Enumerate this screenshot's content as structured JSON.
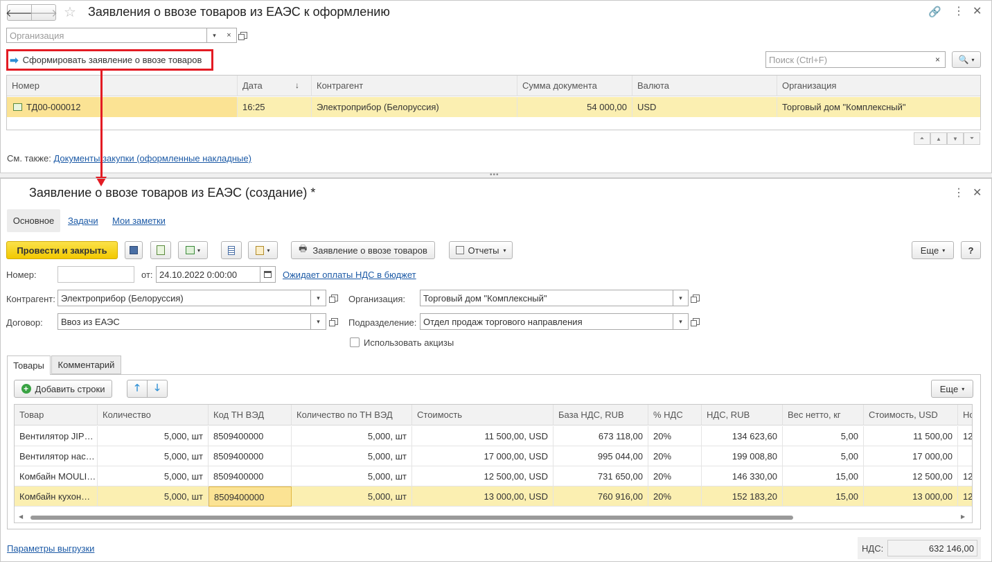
{
  "top": {
    "title": "Заявления о ввозе товаров из ЕАЭС к оформлению",
    "org_placeholder": "Организация",
    "create_button": "Сформировать заявление о ввозе товаров",
    "search_placeholder": "Поиск (Ctrl+F)",
    "columns": [
      "Номер",
      "Дата",
      "Контрагент",
      "Сумма документа",
      "Валюта",
      "Организация"
    ],
    "row": {
      "number": "ТД00-000012",
      "date": "16:25",
      "counterparty": "Электроприбор (Белоруссия)",
      "sum": "54 000,00",
      "currency": "USD",
      "organization": "Торговый дом \"Комплексный\""
    },
    "see_also_label": "См. также:",
    "see_also_link": "Документы закупки (оформленные накладные)"
  },
  "doc": {
    "title": "Заявление о ввозе товаров из ЕАЭС (создание) *",
    "tabs": [
      "Основное",
      "Задачи",
      "Мои заметки"
    ],
    "post_close": "Провести и закрыть",
    "print_button": "Заявление о ввозе товаров",
    "reports_button": "Отчеты",
    "more_button": "Еще",
    "help_button": "?",
    "number_label": "Номер:",
    "number_value": "",
    "from_label": "от:",
    "date_value": "24.10.2022  0:00:00",
    "status_link": "Ожидает оплаты НДС в бюджет",
    "counterparty_label": "Контрагент:",
    "counterparty_value": "Электроприбор (Белоруссия)",
    "contract_label": "Договор:",
    "contract_value": "Ввоз из ЕАЭС",
    "org_label": "Организация:",
    "org_value": "Торговый дом \"Комплексный\"",
    "dept_label": "Подразделение:",
    "dept_value": "Отдел продаж торгового направления",
    "excise_label": "Использовать акцизы",
    "inner_tabs": [
      "Товары",
      "Комментарий"
    ],
    "add_rows": "Добавить строки",
    "more_button2": "Еще",
    "columns": [
      "Товар",
      "Количество",
      "Код ТН ВЭД",
      "Количество по ТН ВЭД",
      "Стоимость",
      "База НДС, RUB",
      "% НДС",
      "НДС, RUB",
      "Вес нетто, кг",
      "Стоимость, USD",
      "Но"
    ],
    "rows": [
      [
        "Вентилятор JIP…",
        "5,000, шт",
        "8509400000",
        "5,000, шт",
        "11 500,00, USD",
        "673 118,00",
        "20%",
        "134 623,60",
        "5,00",
        "11 500,00",
        "12"
      ],
      [
        "Вентилятор нас…",
        "5,000, шт",
        "8509400000",
        "5,000, шт",
        "17 000,00, USD",
        "995 044,00",
        "20%",
        "199 008,80",
        "5,00",
        "17 000,00",
        ""
      ],
      [
        "Комбайн MOULI…",
        "5,000, шт",
        "8509400000",
        "5,000, шт",
        "12 500,00, USD",
        "731 650,00",
        "20%",
        "146 330,00",
        "15,00",
        "12 500,00",
        "12"
      ],
      [
        "Комбайн кухон…",
        "5,000, шт",
        "8509400000",
        "5,000, шт",
        "13 000,00, USD",
        "760 916,00",
        "20%",
        "152 183,20",
        "15,00",
        "13 000,00",
        "12"
      ]
    ],
    "export_params": "Параметры выгрузки",
    "vat_label": "НДС:",
    "vat_value": "632 146,00"
  },
  "colors": {
    "accent_red": "#e31b23",
    "selected_row": "#fbefb1",
    "yellow_button": "#f7d51c",
    "link": "#1c5aa6"
  }
}
